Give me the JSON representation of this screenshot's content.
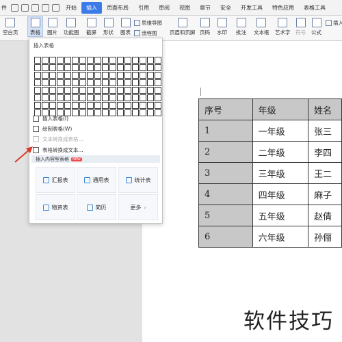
{
  "menubar": {
    "app_label": "件",
    "tabs": [
      "开始",
      "插入",
      "页面布局",
      "引用",
      "审阅",
      "视图",
      "章节",
      "安全",
      "开发工具",
      "特色应用",
      "表格工具"
    ],
    "active_tab": "插入"
  },
  "toolbar": {
    "blank_page": "空白页",
    "table": "表格",
    "picture": "图片",
    "function_chart": "功能图",
    "screenshot": "截屏",
    "shapes": "形状",
    "chart": "图表",
    "mind_map": "思维导图",
    "flowchart": "流程图",
    "header_footer": "页眉和页脚",
    "page_number": "页码",
    "watermark": "水印",
    "comment": "批注",
    "textbox": "文本框",
    "art_text": "艺术字",
    "symbol": "符号",
    "formula": "公式",
    "insert_truncated": "插入"
  },
  "dropdown": {
    "title": "插入表格",
    "insert_table": "插入表格(I)",
    "draw_table": "绘制表格(W)",
    "text_to_table": "文本转换成表格...",
    "table_to_text": "表格转换成文本...",
    "content_tables": "插入内容型表格",
    "new_badge": "NEW",
    "cards": [
      "汇报表",
      "通用表",
      "统计表",
      "物资表",
      "简历",
      "更多"
    ]
  },
  "document": {
    "table": [
      [
        "序号",
        "年级",
        "姓名"
      ],
      [
        "1",
        "一年级",
        "张三"
      ],
      [
        "2",
        "二年级",
        "李四"
      ],
      [
        "3",
        "三年级",
        "王二"
      ],
      [
        "4",
        "四年级",
        "麻子"
      ],
      [
        "5",
        "五年级",
        "赵倩"
      ],
      [
        "6",
        "六年级",
        "孙俪"
      ]
    ]
  },
  "watermark": "软件技巧",
  "colors": {
    "accent": "#3b7be8",
    "arrow": "#d93a2b",
    "header_gray": "#c8c8c8"
  }
}
